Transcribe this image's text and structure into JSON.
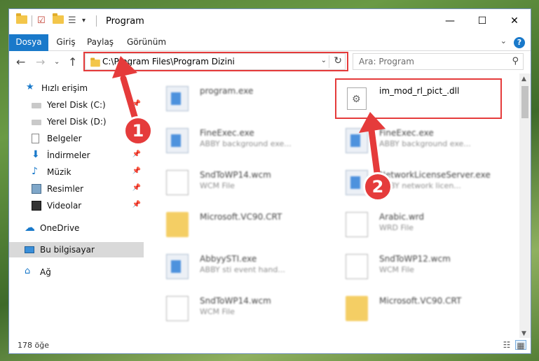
{
  "window": {
    "title": "Program",
    "controls": {
      "minimize": "—",
      "maximize": "☐",
      "close": "✕"
    }
  },
  "ribbon": {
    "tabs": [
      {
        "label": "Dosya",
        "active": true
      },
      {
        "label": "Giriş"
      },
      {
        "label": "Paylaş"
      },
      {
        "label": "Görünüm"
      }
    ],
    "help": "?"
  },
  "nav": {
    "address": "C:\\Program Files\\Program Dizini",
    "search_placeholder": "Ara: Program"
  },
  "sidebar": {
    "items": [
      {
        "label": "Hızlı erişim",
        "icon": "star-icon",
        "pinned": false
      },
      {
        "label": "Yerel Disk (C:)",
        "icon": "drive-icon",
        "pinned": true
      },
      {
        "label": "Yerel Disk (D:)",
        "icon": "drive-icon",
        "pinned": false
      },
      {
        "label": "Belgeler",
        "icon": "documents-icon",
        "pinned": true
      },
      {
        "label": "İndirmeler",
        "icon": "download-icon",
        "pinned": true
      },
      {
        "label": "Müzik",
        "icon": "music-icon",
        "pinned": true
      },
      {
        "label": "Resimler",
        "icon": "pictures-icon",
        "pinned": true
      },
      {
        "label": "Videolar",
        "icon": "videos-icon",
        "pinned": true
      },
      {
        "label": "OneDrive",
        "icon": "cloud-icon",
        "pinned": false
      },
      {
        "label": "Bu bilgisayar",
        "icon": "computer-icon",
        "selected": true
      },
      {
        "label": "Ağ",
        "icon": "network-icon",
        "pinned": false
      }
    ]
  },
  "files": [
    {
      "name": "program.exe",
      "desc": "",
      "kind": "app"
    },
    {
      "name": "im_mod_rl_pict_.dll",
      "desc": "",
      "kind": "dll",
      "highlighted": true
    },
    {
      "name": "FineExec.exe",
      "desc": "ABBY background exe...",
      "kind": "app"
    },
    {
      "name": "FineExec.exe",
      "desc": "ABBY background exe...",
      "kind": "app"
    },
    {
      "name": "SndToWP14.wcm",
      "desc": "WCM File",
      "kind": "doc"
    },
    {
      "name": "NetworkLicenseServer.exe",
      "desc": "ABBY network licen...",
      "kind": "app"
    },
    {
      "name": "Microsoft.VC90.CRT",
      "desc": "",
      "kind": "folder"
    },
    {
      "name": "Arabic.wrd",
      "desc": "WRD File",
      "kind": "doc"
    },
    {
      "name": "AbbyySTI.exe",
      "desc": "ABBY sti event hand...",
      "kind": "app"
    },
    {
      "name": "SndToWP12.wcm",
      "desc": "WCM File",
      "kind": "doc"
    },
    {
      "name": "SndToWP14.wcm",
      "desc": "WCM File",
      "kind": "doc"
    },
    {
      "name": "Microsoft.VC90.CRT",
      "desc": "",
      "kind": "folder"
    }
  ],
  "status": {
    "count": "178 öğe"
  },
  "annotations": {
    "badge1": "1",
    "badge2": "2",
    "color": "#e53b3b"
  },
  "colors": {
    "accent": "#1979ca",
    "highlight": "#e53b3b"
  }
}
